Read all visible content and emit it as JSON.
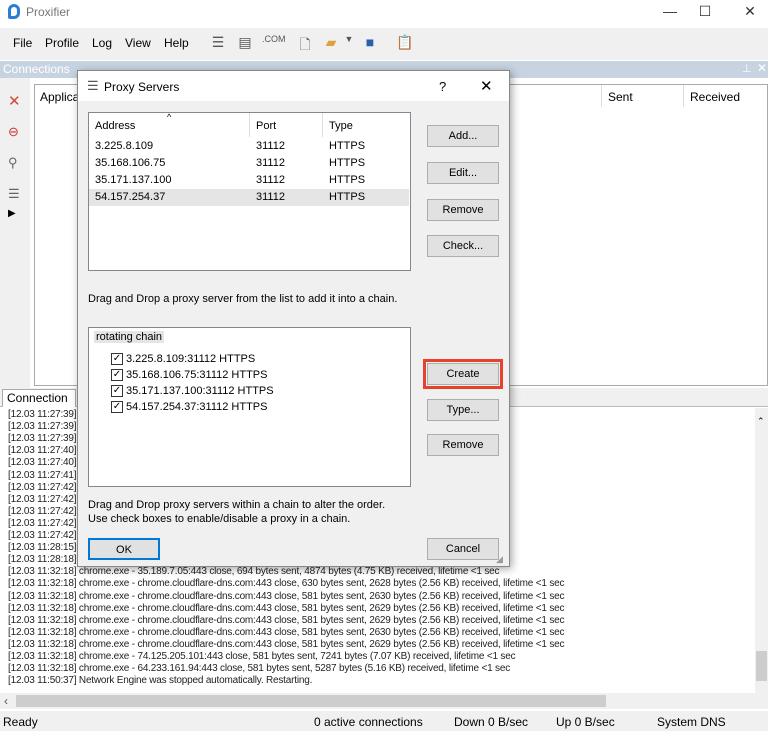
{
  "app": {
    "title": "Proxifier"
  },
  "menu": [
    "File",
    "Profile",
    "Log",
    "View",
    "Help"
  ],
  "connections_panel": {
    "title": "Connections",
    "columns": [
      "Applica",
      "Sent",
      "Received"
    ]
  },
  "bottom_tab": "Connection",
  "log": [
    "[12.03 11:27:39]",
    "[12.03 11:27:39]",
    "[12.03 11:27:39]",
    "[12.03 11:27:40]",
    "[12.03 11:27:40]",
    "[12.03 11:27:41]",
    "[12.03 11:27:42]",
    "[12.03 11:27:42]",
    "[12.03 11:27:42]",
    "[12.03 11:27:42]",
    "[12.03 11:27:42]",
    "[12.03 11:28:15] chrome.exe - ... received, lifetime <1 sec",
    "[12.03 11:28:18] chrome.exe - ... lifetime <1 sec",
    "[12.03 11:32:18] chrome.exe - 35.189.7.05:443 close, 694 bytes sent, 4874 bytes (4.75 KB) received, lifetime <1 sec",
    "[12.03 11:32:18] chrome.exe - chrome.cloudflare-dns.com:443 close, 630 bytes sent, 2628 bytes (2.56 KB) received, lifetime <1 sec",
    "[12.03 11:32:18] chrome.exe - chrome.cloudflare-dns.com:443 close, 581 bytes sent, 2630 bytes (2.56 KB) received, lifetime <1 sec",
    "[12.03 11:32:18] chrome.exe - chrome.cloudflare-dns.com:443 close, 581 bytes sent, 2629 bytes (2.56 KB) received, lifetime <1 sec",
    "[12.03 11:32:18] chrome.exe - chrome.cloudflare-dns.com:443 close, 581 bytes sent, 2629 bytes (2.56 KB) received, lifetime <1 sec",
    "[12.03 11:32:18] chrome.exe - chrome.cloudflare-dns.com:443 close, 581 bytes sent, 2630 bytes (2.56 KB) received, lifetime <1 sec",
    "[12.03 11:32:18] chrome.exe - chrome.cloudflare-dns.com:443 close, 581 bytes sent, 2629 bytes (2.56 KB) received, lifetime <1 sec",
    "[12.03 11:32:18] chrome.exe - 74.125.205.101:443 close, 581 bytes sent, 7241 bytes (7.07 KB) received, lifetime <1 sec",
    "[12.03 11:32:18] chrome.exe - 64.233.161.94:443 close, 581 bytes sent, 5287 bytes (5.16 KB) received, lifetime <1 sec",
    "[12.03 11:50:37] Network Engine was stopped automatically. Restarting."
  ],
  "status": {
    "ready": "Ready",
    "connections": "0 active connections",
    "down": "Down 0 B/sec",
    "up": "Up 0 B/sec",
    "dns": "System DNS"
  },
  "dialog": {
    "title": "Proxy Servers",
    "help": "?",
    "close": "✕",
    "columns": [
      "Address",
      "Port",
      "Type"
    ],
    "servers": [
      {
        "address": "3.225.8.109",
        "port": "31112",
        "type": "HTTPS"
      },
      {
        "address": "35.168.106.75",
        "port": "31112",
        "type": "HTTPS"
      },
      {
        "address": "35.171.137.100",
        "port": "31112",
        "type": "HTTPS"
      },
      {
        "address": "54.157.254.37",
        "port": "31112",
        "type": "HTTPS"
      }
    ],
    "server_buttons": [
      "Add...",
      "Edit...",
      "Remove",
      "Check..."
    ],
    "hint1": "Drag and Drop a proxy server from the list to add it into a chain.",
    "chain": {
      "name": "rotating chain",
      "items": [
        {
          "label": "3.225.8.109:31112 HTTPS",
          "checked": true
        },
        {
          "label": "35.168.106.75:31112 HTTPS",
          "checked": true
        },
        {
          "label": "35.171.137.100:31112 HTTPS",
          "checked": true
        },
        {
          "label": "54.157.254.37:31112 HTTPS",
          "checked": true
        }
      ]
    },
    "chain_buttons": [
      "Create",
      "Type...",
      "Remove"
    ],
    "hint2": "Drag and Drop proxy servers within a chain to alter the order.",
    "hint3": "Use check boxes to enable/disable a proxy in a chain.",
    "ok": "OK",
    "cancel": "Cancel",
    "highlight_color": "#e8412c"
  }
}
